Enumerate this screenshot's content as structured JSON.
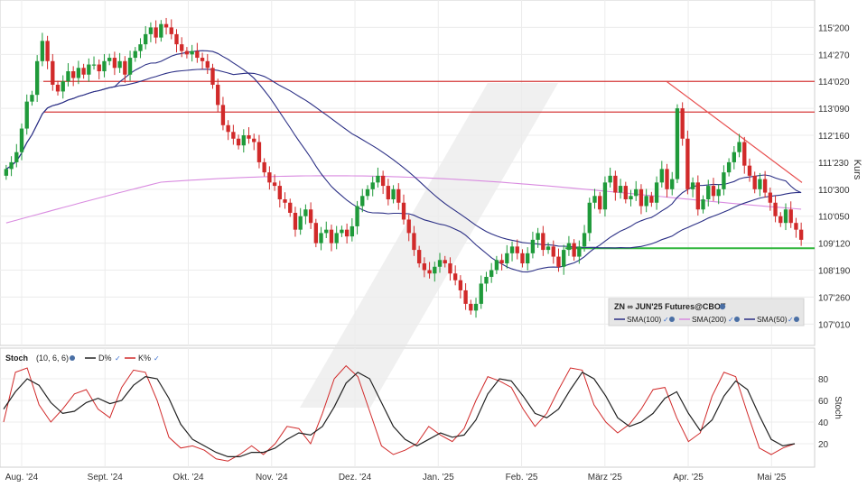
{
  "chart_data": {
    "type": "candlestick",
    "instrument": "ZN ∞ JUN'25 Futures@CBOT",
    "y_axis_label": "Kurs",
    "y_ticks": [
      "115'200",
      "114'270",
      "114'020",
      "113'090",
      "112'160",
      "111'230",
      "110'300",
      "110'050",
      "109'120",
      "108'190",
      "107'260",
      "107'010"
    ],
    "y_tick_values": [
      115.6,
      114.8,
      114.0,
      113.2,
      112.4,
      111.6,
      110.8,
      110.0,
      109.2,
      108.4,
      107.6,
      106.8
    ],
    "x_labels": [
      "Aug. '24",
      "Sept. '24",
      "Okt. '24",
      "Nov. '24",
      "Dez. '24",
      "Jan. '25",
      "Feb. '25",
      "März '25",
      "Apr. '25",
      "Mai '25"
    ],
    "ylim": [
      106.3,
      116.2
    ],
    "legend": [
      {
        "label": "SMA(100)",
        "color": "#2b2f85"
      },
      {
        "label": "SMA(200)",
        "color": "#d98be0"
      },
      {
        "label": "SMA(50)",
        "color": "#2b2f85"
      }
    ],
    "colors": {
      "up": "#1f9a3a",
      "down": "#d12a2a",
      "resistance": "#d63a3a",
      "support": "#2fb53a",
      "sma100": "#2b2f85",
      "sma200": "#d98be0",
      "sma50": "#2b2f85"
    },
    "lines": {
      "resistance_upper": 114.0,
      "resistance_lower": 113.09,
      "support": 109.05,
      "trendline": {
        "from_price": 114.0,
        "to_price": 111.0
      }
    },
    "ohlc_closes": [
      111.4,
      111.6,
      111.9,
      112.6,
      113.4,
      113.6,
      114.6,
      115.2,
      114.6,
      113.9,
      113.7,
      114.0,
      114.3,
      114.1,
      114.4,
      114.2,
      114.5,
      114.5,
      114.3,
      114.6,
      114.7,
      114.4,
      114.6,
      114.2,
      114.7,
      114.9,
      115.1,
      115.4,
      115.6,
      115.3,
      115.7,
      115.6,
      115.4,
      115.1,
      114.9,
      114.8,
      114.9,
      114.7,
      114.6,
      114.4,
      113.9,
      113.3,
      112.7,
      112.5,
      112.3,
      112.1,
      112.4,
      112.3,
      112.2,
      111.6,
      111.3,
      111.0,
      110.9,
      110.5,
      110.4,
      110.1,
      109.6,
      110.0,
      110.2,
      109.8,
      109.2,
      109.5,
      109.6,
      109.2,
      109.5,
      109.6,
      109.4,
      109.7,
      110.3,
      110.6,
      110.8,
      111.0,
      111.2,
      110.9,
      110.5,
      110.8,
      110.4,
      109.9,
      109.5,
      109.0,
      108.6,
      108.4,
      108.3,
      108.5,
      108.7,
      108.6,
      108.3,
      108.1,
      107.8,
      107.4,
      107.2,
      107.4,
      108.0,
      108.2,
      108.4,
      108.7,
      108.6,
      108.9,
      109.1,
      108.9,
      108.6,
      108.9,
      109.3,
      109.5,
      109.0,
      109.1,
      108.8,
      108.5,
      109.0,
      109.2,
      108.8,
      109.1,
      109.5,
      110.4,
      110.6,
      110.2,
      111.0,
      111.2,
      110.7,
      110.9,
      110.5,
      110.6,
      110.8,
      110.3,
      110.6,
      110.4,
      111.0,
      111.4,
      110.8,
      111.1,
      113.2,
      112.3,
      110.8,
      111.0,
      110.2,
      110.5,
      110.9,
      110.6,
      110.8,
      111.3,
      111.6,
      111.9,
      112.2,
      111.5,
      111.2,
      110.8,
      111.1,
      110.7,
      110.4,
      110.0,
      109.8,
      110.2,
      109.8,
      109.6,
      109.3
    ],
    "stoch": {
      "label": "Stoch",
      "params": "(10, 6, 6)",
      "series": [
        {
          "name": "D%",
          "color": "#222222"
        },
        {
          "name": "K%",
          "color": "#d12a2a"
        }
      ],
      "y_ticks": [
        80,
        60,
        40,
        20
      ],
      "d_values": [
        52,
        68,
        80,
        74,
        58,
        48,
        50,
        58,
        62,
        57,
        60,
        74,
        82,
        80,
        62,
        38,
        24,
        18,
        12,
        8,
        8,
        12,
        12,
        16,
        24,
        30,
        28,
        36,
        54,
        76,
        86,
        80,
        58,
        36,
        24,
        18,
        24,
        30,
        26,
        28,
        42,
        66,
        80,
        78,
        64,
        48,
        44,
        52,
        70,
        86,
        80,
        64,
        44,
        36,
        40,
        48,
        62,
        68,
        48,
        32,
        42,
        64,
        78,
        70,
        46,
        24,
        18,
        20
      ],
      "k_values": [
        40,
        86,
        90,
        56,
        40,
        52,
        66,
        70,
        52,
        44,
        72,
        88,
        86,
        60,
        26,
        16,
        18,
        14,
        6,
        4,
        10,
        18,
        10,
        20,
        36,
        34,
        20,
        48,
        80,
        92,
        82,
        50,
        18,
        10,
        14,
        20,
        36,
        28,
        22,
        34,
        60,
        82,
        78,
        72,
        52,
        36,
        48,
        70,
        90,
        88,
        56,
        40,
        30,
        38,
        52,
        70,
        72,
        44,
        22,
        30,
        64,
        86,
        82,
        48,
        16,
        10,
        16,
        20
      ],
      "axis_label": "Stoch"
    }
  }
}
